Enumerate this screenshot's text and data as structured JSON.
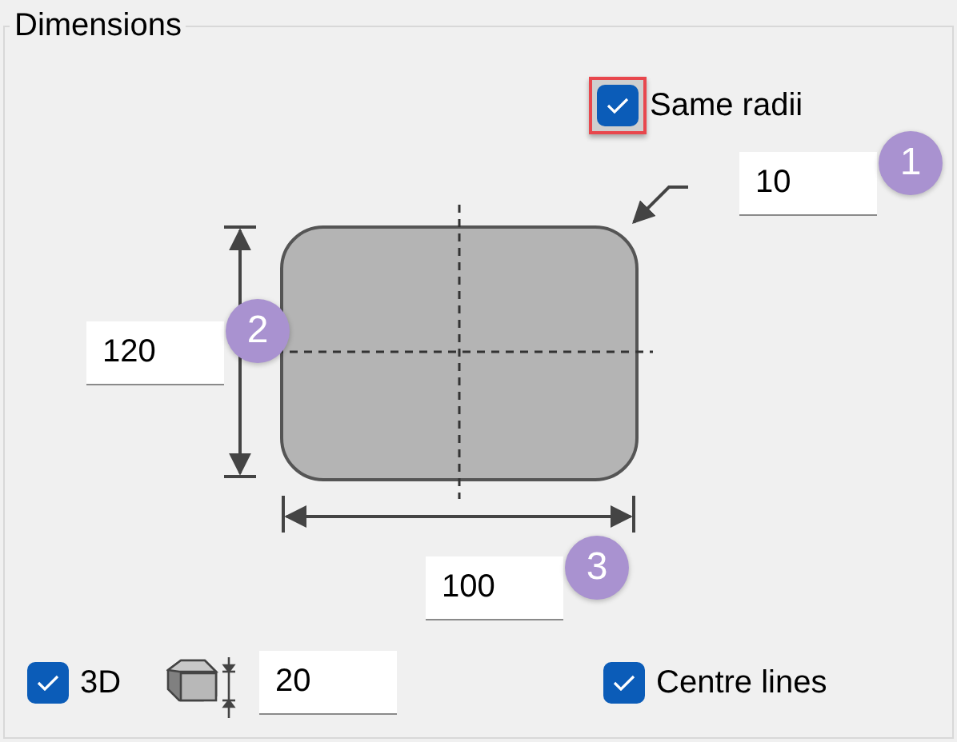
{
  "group": {
    "title": "Dimensions"
  },
  "same_radii": {
    "label": "Same radii",
    "checked": true,
    "highlighted": true
  },
  "radius": {
    "value": "10",
    "badge": "1"
  },
  "height": {
    "value": "120",
    "badge": "2"
  },
  "width": {
    "value": "100",
    "badge": "3"
  },
  "three_d": {
    "label": "3D",
    "checked": true
  },
  "thickness": {
    "value": "20"
  },
  "centre_lines": {
    "label": "Centre lines",
    "checked": true
  }
}
